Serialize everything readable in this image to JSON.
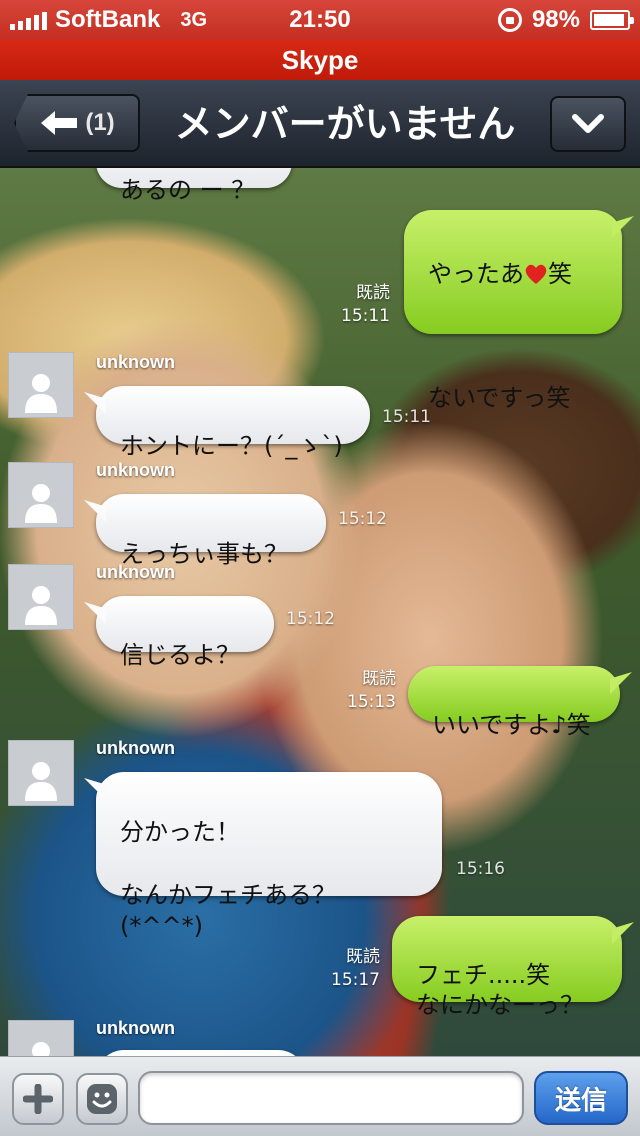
{
  "status_bar": {
    "carrier": "SoftBank",
    "network": "3G",
    "time": "21:50",
    "battery": "98%"
  },
  "app_bar": {
    "title": "Skype"
  },
  "nav": {
    "back_count": "(1)",
    "title": "メンバーがいません"
  },
  "messages": [
    {
      "dir": "in",
      "sender": "",
      "text": "あるの ー ？",
      "time": ""
    },
    {
      "dir": "out",
      "text_before_heart": "やったあ",
      "text_after_heart": "笑",
      "text_line2": "ないですっ笑",
      "read": "既読",
      "time": "15:11"
    },
    {
      "dir": "in",
      "sender": "unknown",
      "text": "ホントにー？(´_ゝ`)",
      "time": "15:11"
    },
    {
      "dir": "in",
      "sender": "unknown",
      "text": "えっちぃ事も？",
      "time": "15:12"
    },
    {
      "dir": "in",
      "sender": "unknown",
      "text": "信じるよ？",
      "time": "15:12"
    },
    {
      "dir": "out",
      "text": "いいですよ♪笑",
      "read": "既読",
      "time": "15:13"
    },
    {
      "dir": "in",
      "sender": "unknown",
      "text": "分かった！\n\nなんかフェチある？(*^^*)",
      "time": "15:16"
    },
    {
      "dir": "out",
      "text": "フェチ.....笑\nなにかなーっ？",
      "read": "既読",
      "time": "15:17"
    },
    {
      "dir": "in",
      "sender": "unknown",
      "text": "",
      "time": ""
    }
  ],
  "input_bar": {
    "placeholder": "",
    "send_label": "送信"
  },
  "icons": {
    "back": "back-arrow-icon",
    "menu": "chevron-down-icon",
    "avatar": "person-silhouette-icon",
    "heart": "heart-icon",
    "plus": "plus-icon",
    "emoji": "smiley-icon"
  },
  "colors": {
    "status_bar": "#c52e22",
    "app_bar": "#c01a08",
    "nav_bar": "#2a313b",
    "incoming_bubble": "#f2f3f5",
    "outgoing_bubble": "#a6dc3f",
    "send_button": "#2f74d6"
  }
}
